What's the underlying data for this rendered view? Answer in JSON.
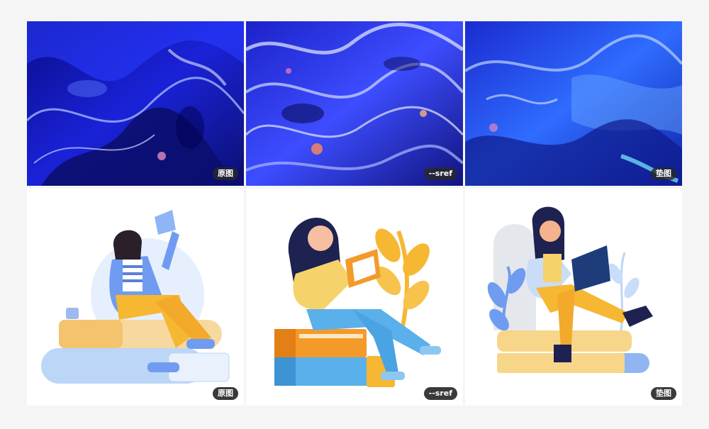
{
  "top_row": [
    {
      "badge": "原图",
      "image": "blue-glass-wave-original"
    },
    {
      "badge": "--sref",
      "image": "blue-chrome-liquid-sref"
    },
    {
      "badge": "垫图",
      "image": "blue-glass-wave-image-prompt"
    }
  ],
  "bottom_row": [
    {
      "badge": "原图",
      "image": "woman-reading-on-books-original"
    },
    {
      "badge": "--sref",
      "image": "woman-reading-on-books-sref"
    },
    {
      "badge": "垫图",
      "image": "woman-reading-on-books-image-prompt"
    }
  ],
  "colors": {
    "background": "#f5f5f5",
    "deep_blue": "#1a1fd6",
    "electric_blue": "#3b5bff",
    "illustration_blue": "#6f9cf0",
    "illustration_yellow": "#f6b733",
    "illustration_orange": "#f39a2b",
    "badge_bg": "#333333"
  }
}
